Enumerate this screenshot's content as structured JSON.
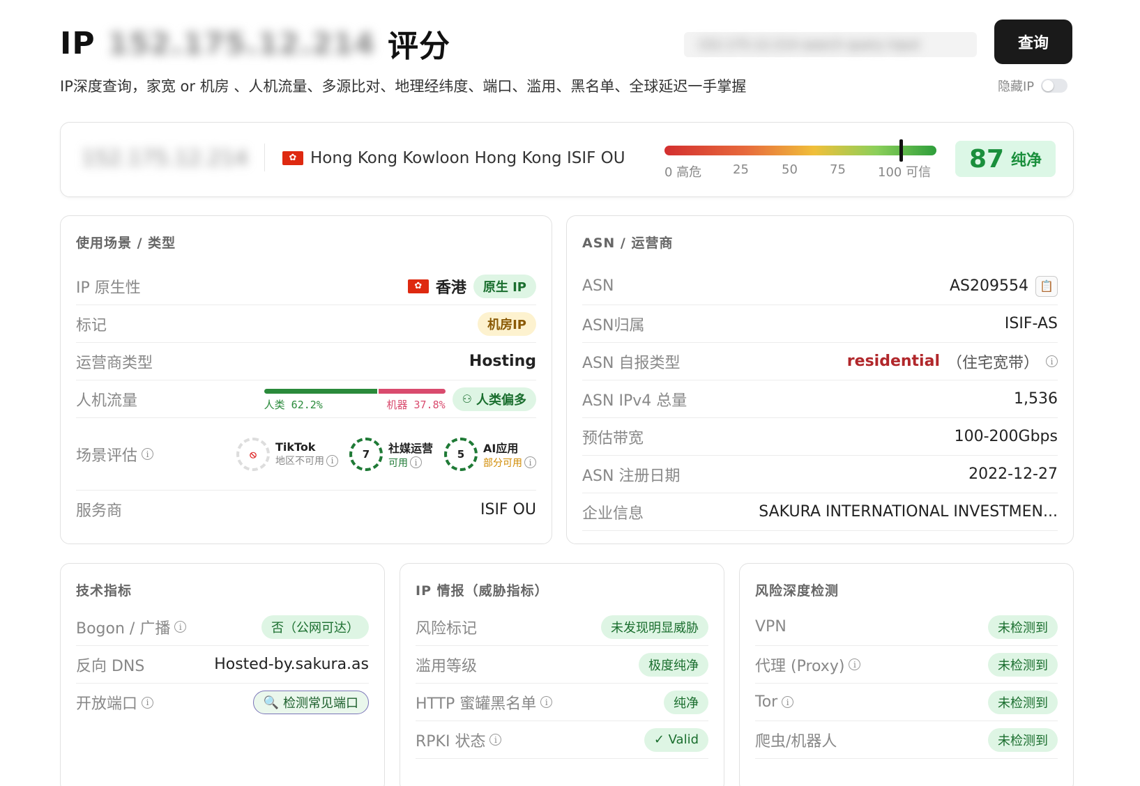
{
  "header": {
    "title_prefix": "IP",
    "title_ip": "152.175.12.214",
    "title_suffix": "评分",
    "subtitle": "IP深度查询，家宽 or 机房 、人机流量、多源比对、地理经纬度、端口、滥用、黑名单、全球延迟一手掌握",
    "search_value": "152.175.12.214 search query input",
    "query_label": "查询",
    "hide_ip_label": "隐藏IP"
  },
  "summary": {
    "ip": "152.175.12.214",
    "location": "Hong Kong Kowloon Hong Kong ISIF OU",
    "gauge_ticks": [
      "0 高危",
      "25",
      "50",
      "75",
      "100 可信"
    ],
    "score": 87,
    "score_label": "纯净"
  },
  "usage": {
    "title": "使用场景 / 类型",
    "ip_native_label": "IP 原生性",
    "region": "香港",
    "native_badge": "原生 IP",
    "tag_label": "标记",
    "tag_value": "机房IP",
    "isp_type_label": "运营商类型",
    "isp_type_value": "Hosting",
    "traffic_label": "人机流量",
    "human_label": "人类 62.2%",
    "human_pct": 62.2,
    "bot_label": "机器 37.8%",
    "traffic_badge": "人类偏多",
    "scenario_label": "场景评估",
    "scenarios": [
      {
        "name": "TikTok",
        "status": "地区不可用",
        "score": ""
      },
      {
        "name": "社媒运营",
        "status": "可用",
        "score": "7"
      },
      {
        "name": "AI应用",
        "status": "部分可用",
        "score": "5"
      }
    ],
    "provider_label": "服务商",
    "provider_value": "ISIF OU"
  },
  "asn": {
    "title": "ASN / 运营商",
    "rows": [
      {
        "label": "ASN",
        "value": "AS209554"
      },
      {
        "label": "ASN归属",
        "value": "ISIF-AS"
      },
      {
        "label": "ASN 自报类型",
        "value": "residential",
        "extra": "（住宅宽带）"
      },
      {
        "label": "ASN IPv4 总量",
        "value": "1,536"
      },
      {
        "label": "预估带宽",
        "value": "100-200Gbps"
      },
      {
        "label": "ASN 注册日期",
        "value": "2022-12-27"
      },
      {
        "label": "企业信息",
        "value": "SAKURA INTERNATIONAL INVESTMEN..."
      }
    ]
  },
  "tech": {
    "title": "技术指标",
    "bogon_label": "Bogon / 广播",
    "bogon_value": "否（公网可达）",
    "rdns_label": "反向 DNS",
    "rdns_value": "Hosted-by.sakura.as",
    "ports_label": "开放端口",
    "ports_button": "检测常见端口"
  },
  "intel": {
    "title": "IP 情报（威胁指标）",
    "rows": [
      {
        "label": "风险标记",
        "value": "未发现明显威胁",
        "info": false
      },
      {
        "label": "滥用等级",
        "value": "极度纯净",
        "info": false
      },
      {
        "label": "HTTP 蜜罐黑名单",
        "value": "纯净",
        "info": true
      },
      {
        "label": "RPKI 状态",
        "value": "✓ Valid",
        "info": true
      }
    ]
  },
  "risk": {
    "title": "风险深度检测",
    "rows": [
      {
        "label": "VPN",
        "value": "未检测到",
        "info": false
      },
      {
        "label": "代理 (Proxy)",
        "value": "未检测到",
        "info": true
      },
      {
        "label": "Tor",
        "value": "未检测到",
        "info": true
      },
      {
        "label": "爬虫/机器人",
        "value": "未检测到",
        "info": false
      }
    ]
  },
  "colors": {
    "accent_green": "#1a8f3c",
    "danger_red": "#b1272b",
    "bot_pink": "#d94b6e"
  }
}
